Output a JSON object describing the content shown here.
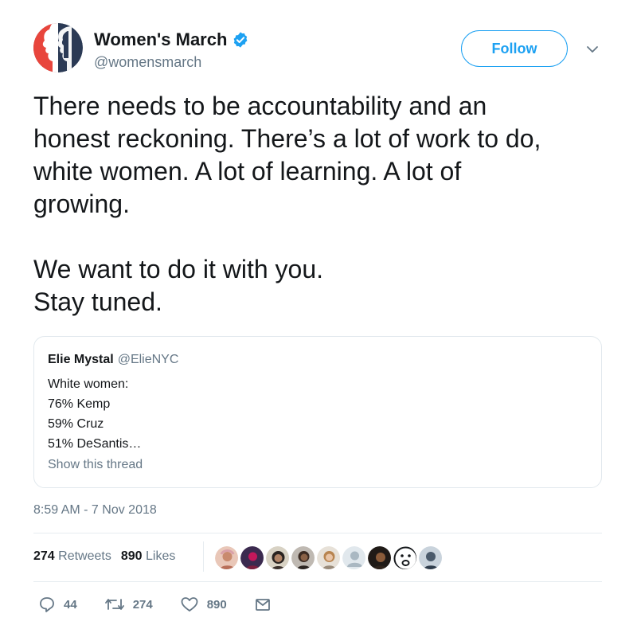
{
  "author": {
    "display_name": "Women's March",
    "handle": "@womensmarch",
    "verified": true,
    "avatar_icon": "womens-march-logo"
  },
  "follow_label": "Follow",
  "tweet": {
    "paragraph_1": "There needs to be accountability and an\nhonest reckoning. There’s a lot of work to do,\nwhite women. A lot of learning. A lot of\ngrowing.",
    "paragraph_2": "We want to do it with you.\nStay tuned."
  },
  "quoted_tweet": {
    "name": "Elie Mystal",
    "handle": "@ElieNYC",
    "lines": [
      "White women:",
      "76% Kemp",
      "59% Cruz",
      "51% DeSantis…"
    ],
    "show_thread": "Show this thread"
  },
  "timestamp": "8:59 AM - 7 Nov 2018",
  "stats": {
    "retweets_count": "274",
    "retweets_label": "Retweets",
    "likes_count": "890",
    "likes_label": "Likes"
  },
  "likers": [
    {
      "icon": "user-avatar"
    },
    {
      "icon": "user-avatar"
    },
    {
      "icon": "user-avatar"
    },
    {
      "icon": "user-avatar"
    },
    {
      "icon": "user-avatar"
    },
    {
      "icon": "default-avatar"
    },
    {
      "icon": "user-avatar"
    },
    {
      "icon": "emoji-avatar"
    },
    {
      "icon": "user-avatar"
    }
  ],
  "actions": {
    "reply_count": "44",
    "retweet_count": "274",
    "like_count": "890"
  },
  "colors": {
    "accent": "#1da1f2",
    "secondary_text": "#657786",
    "brand_red": "#e8453c",
    "brand_navy": "#2b3a55"
  }
}
